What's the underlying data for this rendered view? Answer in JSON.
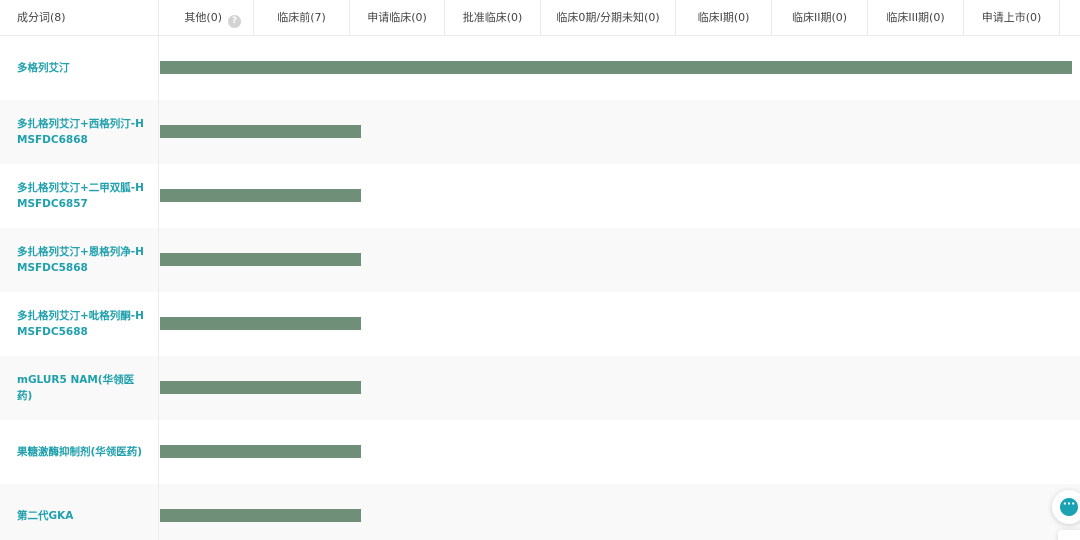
{
  "header": {
    "component_col": "成分词(8)",
    "phases": [
      "其他(0)",
      "临床前(7)",
      "申请临床(0)",
      "批准临床(0)",
      "临床0期/分期未知(0)",
      "临床I期(0)",
      "临床II期(0)",
      "临床III期(0)",
      "申请上市(0)"
    ],
    "help_glyph": "?"
  },
  "rows": [
    {
      "label": "多格列艾汀",
      "fraction": 1.0
    },
    {
      "label": "多扎格列艾汀+西格列汀-HMSFDC6868",
      "fraction": 0.22
    },
    {
      "label": "多扎格列艾汀+二甲双胍-HMSFDC6857",
      "fraction": 0.22
    },
    {
      "label": "多扎格列艾汀+恩格列净-HMSFDC5868",
      "fraction": 0.22
    },
    {
      "label": "多扎格列艾汀+吡格列酮-HMSFDC5688",
      "fraction": 0.22
    },
    {
      "label": "mGLUR5 NAM(华领医药)",
      "fraction": 0.22
    },
    {
      "label": "果糖激酶抑制剂(华领医药)",
      "fraction": 0.22
    },
    {
      "label": "第二代GKA",
      "fraction": 0.22
    }
  ],
  "colors": {
    "bar": "#6f8f79",
    "link": "#1fa0ad",
    "chat": "#1aa2b4"
  },
  "icons": {
    "help": "help-icon",
    "chat": "chat-icon"
  }
}
